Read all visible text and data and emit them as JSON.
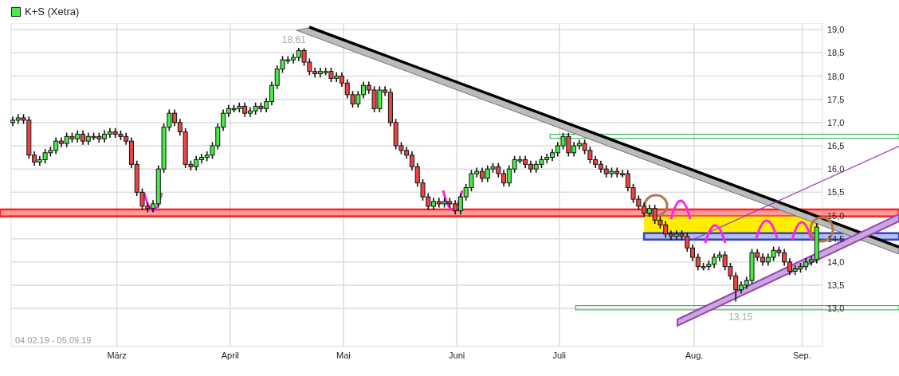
{
  "legend": {
    "label": "K+S (Xetra)",
    "color": "#44ee44"
  },
  "date_range": "04.02.19 - 05.09.19",
  "chart_data": {
    "type": "candlestick",
    "grid": true,
    "ylim": [
      12.18,
      19.14
    ],
    "yticks": [
      {
        "value": 13,
        "label": "13,0"
      },
      {
        "value": 13.5,
        "label": "13,5"
      },
      {
        "value": 14,
        "label": "14,0"
      },
      {
        "value": 14.5,
        "label": "14,5"
      },
      {
        "value": 15,
        "label": "15,0"
      },
      {
        "value": 15.5,
        "label": "15,5"
      },
      {
        "value": 16,
        "label": "16,0"
      },
      {
        "value": 16.5,
        "label": "16,5"
      },
      {
        "value": 17,
        "label": "17,0"
      },
      {
        "value": 17.5,
        "label": "17,5"
      },
      {
        "value": 18,
        "label": "18,0"
      },
      {
        "value": 18.5,
        "label": "18,5"
      },
      {
        "value": 19,
        "label": "19,0"
      }
    ],
    "categories": [
      null,
      null,
      null,
      null,
      null,
      null,
      null,
      null,
      null,
      null,
      null,
      null,
      null,
      null,
      null,
      null,
      null,
      null,
      null,
      "März",
      null,
      null,
      null,
      null,
      null,
      null,
      null,
      null,
      null,
      null,
      null,
      null,
      null,
      null,
      null,
      null,
      null,
      null,
      null,
      null,
      "April",
      null,
      null,
      null,
      null,
      null,
      null,
      null,
      null,
      null,
      null,
      null,
      null,
      null,
      null,
      null,
      null,
      null,
      null,
      null,
      null,
      "Mai",
      null,
      null,
      null,
      null,
      null,
      null,
      null,
      null,
      null,
      null,
      null,
      null,
      null,
      null,
      null,
      null,
      null,
      null,
      null,
      null,
      "Juni",
      null,
      null,
      null,
      null,
      null,
      null,
      null,
      null,
      null,
      null,
      null,
      null,
      null,
      null,
      null,
      null,
      null,
      null,
      "Juli",
      null,
      null,
      null,
      null,
      null,
      null,
      null,
      null,
      null,
      null,
      null,
      null,
      null,
      null,
      null,
      null,
      null,
      null,
      null,
      null,
      null,
      null,
      null,
      null,
      "Aug.",
      null,
      null,
      null,
      null,
      null,
      null,
      null,
      null,
      null,
      null,
      null,
      null,
      null,
      null,
      null,
      null,
      null,
      null,
      null,
      "Sep.",
      null,
      null,
      null
    ],
    "ohlc": [
      [
        17.0,
        17.13,
        16.92,
        17.05
      ],
      [
        17.05,
        17.18,
        16.97,
        17.1
      ],
      [
        17.1,
        17.18,
        16.97,
        17.05
      ],
      [
        17.05,
        17.13,
        16.22,
        16.3
      ],
      [
        16.3,
        16.38,
        16.07,
        16.15
      ],
      [
        16.15,
        16.28,
        16.07,
        16.2
      ],
      [
        16.2,
        16.43,
        16.12,
        16.35
      ],
      [
        16.35,
        16.48,
        16.27,
        16.4
      ],
      [
        16.4,
        16.68,
        16.32,
        16.6
      ],
      [
        16.6,
        16.68,
        16.47,
        16.55
      ],
      [
        16.55,
        16.78,
        16.47,
        16.7
      ],
      [
        16.7,
        16.78,
        16.57,
        16.65
      ],
      [
        16.65,
        16.83,
        16.57,
        16.75
      ],
      [
        16.75,
        16.83,
        16.52,
        16.6
      ],
      [
        16.6,
        16.78,
        16.52,
        16.7
      ],
      [
        16.7,
        16.78,
        16.62,
        16.7
      ],
      [
        16.7,
        16.78,
        16.57,
        16.65
      ],
      [
        16.65,
        16.83,
        16.57,
        16.75
      ],
      [
        16.75,
        16.88,
        16.67,
        16.8
      ],
      [
        16.8,
        16.88,
        16.67,
        16.75
      ],
      [
        16.75,
        16.83,
        16.62,
        16.7
      ],
      [
        16.7,
        16.78,
        16.52,
        16.6
      ],
      [
        16.6,
        16.68,
        16.02,
        16.1
      ],
      [
        16.1,
        16.18,
        15.42,
        15.5
      ],
      [
        15.5,
        15.58,
        15.12,
        15.2
      ],
      [
        15.2,
        15.28,
        15.07,
        15.15
      ],
      [
        15.15,
        15.33,
        15.07,
        15.25
      ],
      [
        15.25,
        16.08,
        15.17,
        16.0
      ],
      [
        16.0,
        16.98,
        15.92,
        16.9
      ],
      [
        16.9,
        17.28,
        16.82,
        17.2
      ],
      [
        17.2,
        17.28,
        16.92,
        17.0
      ],
      [
        17.0,
        17.08,
        16.72,
        16.8
      ],
      [
        16.8,
        16.88,
        16.02,
        16.1
      ],
      [
        16.1,
        16.18,
        15.97,
        16.05
      ],
      [
        16.05,
        16.28,
        15.97,
        16.2
      ],
      [
        16.2,
        16.33,
        16.12,
        16.25
      ],
      [
        16.25,
        16.38,
        16.17,
        16.3
      ],
      [
        16.3,
        16.58,
        16.22,
        16.5
      ],
      [
        16.5,
        16.98,
        16.42,
        16.9
      ],
      [
        16.9,
        17.28,
        16.82,
        17.2
      ],
      [
        17.2,
        17.38,
        17.12,
        17.3
      ],
      [
        17.3,
        17.38,
        17.22,
        17.3
      ],
      [
        17.3,
        17.43,
        17.22,
        17.35
      ],
      [
        17.35,
        17.43,
        17.12,
        17.2
      ],
      [
        17.2,
        17.33,
        17.12,
        17.25
      ],
      [
        17.25,
        17.43,
        17.17,
        17.35
      ],
      [
        17.35,
        17.43,
        17.22,
        17.3
      ],
      [
        17.3,
        17.53,
        17.22,
        17.45
      ],
      [
        17.45,
        17.88,
        17.37,
        17.8
      ],
      [
        17.8,
        18.23,
        17.72,
        18.15
      ],
      [
        18.15,
        18.43,
        18.07,
        18.35
      ],
      [
        18.35,
        18.43,
        18.27,
        18.35
      ],
      [
        18.35,
        18.48,
        18.27,
        18.4
      ],
      [
        18.4,
        18.61,
        18.32,
        18.55
      ],
      [
        18.55,
        18.6,
        18.22,
        18.3
      ],
      [
        18.3,
        18.38,
        18.02,
        18.1
      ],
      [
        18.1,
        18.18,
        17.97,
        18.05
      ],
      [
        18.05,
        18.18,
        17.97,
        18.1
      ],
      [
        18.1,
        18.18,
        18.02,
        18.1
      ],
      [
        18.1,
        18.18,
        17.87,
        17.95
      ],
      [
        17.95,
        18.08,
        17.87,
        18.0
      ],
      [
        18.0,
        18.08,
        17.77,
        17.85
      ],
      [
        17.85,
        17.93,
        17.52,
        17.6
      ],
      [
        17.6,
        17.68,
        17.32,
        17.4
      ],
      [
        17.4,
        17.68,
        17.32,
        17.6
      ],
      [
        17.6,
        17.88,
        17.52,
        17.8
      ],
      [
        17.8,
        17.88,
        17.62,
        17.7
      ],
      [
        17.7,
        17.78,
        17.22,
        17.3
      ],
      [
        17.3,
        17.78,
        17.22,
        17.7
      ],
      [
        17.7,
        17.78,
        17.57,
        17.65
      ],
      [
        17.65,
        17.73,
        16.92,
        17.0
      ],
      [
        17.0,
        17.08,
        16.42,
        16.5
      ],
      [
        16.5,
        16.58,
        16.32,
        16.4
      ],
      [
        16.4,
        16.48,
        16.22,
        16.3
      ],
      [
        16.3,
        16.38,
        15.97,
        16.05
      ],
      [
        16.05,
        16.13,
        15.62,
        15.7
      ],
      [
        15.7,
        15.78,
        15.32,
        15.4
      ],
      [
        15.4,
        15.48,
        15.12,
        15.2
      ],
      [
        15.2,
        15.38,
        15.12,
        15.3
      ],
      [
        15.3,
        15.38,
        15.17,
        15.25
      ],
      [
        15.25,
        15.38,
        15.17,
        15.3
      ],
      [
        15.3,
        15.38,
        15.17,
        15.25
      ],
      [
        15.25,
        15.33,
        15.02,
        15.1
      ],
      [
        15.1,
        15.48,
        15.02,
        15.4
      ],
      [
        15.4,
        15.68,
        15.32,
        15.6
      ],
      [
        15.6,
        15.98,
        15.52,
        15.9
      ],
      [
        15.9,
        16.03,
        15.82,
        15.95
      ],
      [
        15.95,
        16.03,
        15.72,
        15.8
      ],
      [
        15.8,
        16.08,
        15.72,
        16.0
      ],
      [
        16.0,
        16.13,
        15.92,
        16.05
      ],
      [
        16.05,
        16.13,
        15.82,
        15.9
      ],
      [
        15.9,
        15.98,
        15.62,
        15.7
      ],
      [
        15.7,
        16.08,
        15.62,
        16.0
      ],
      [
        16.0,
        16.28,
        15.92,
        16.2
      ],
      [
        16.2,
        16.28,
        16.12,
        16.2
      ],
      [
        16.2,
        16.28,
        16.02,
        16.1
      ],
      [
        16.1,
        16.18,
        15.92,
        16.0
      ],
      [
        16.0,
        16.18,
        15.92,
        16.1
      ],
      [
        16.1,
        16.28,
        16.02,
        16.2
      ],
      [
        16.2,
        16.33,
        16.12,
        16.25
      ],
      [
        16.25,
        16.43,
        16.17,
        16.35
      ],
      [
        16.35,
        16.58,
        16.27,
        16.5
      ],
      [
        16.5,
        16.78,
        16.42,
        16.7
      ],
      [
        16.7,
        16.78,
        16.27,
        16.35
      ],
      [
        16.35,
        16.58,
        16.27,
        16.5
      ],
      [
        16.5,
        16.63,
        16.42,
        16.55
      ],
      [
        16.55,
        16.63,
        16.32,
        16.4
      ],
      [
        16.4,
        16.48,
        16.12,
        16.2
      ],
      [
        16.2,
        16.28,
        16.02,
        16.1
      ],
      [
        16.1,
        16.18,
        15.92,
        16.0
      ],
      [
        16.0,
        16.08,
        15.82,
        15.9
      ],
      [
        15.9,
        16.03,
        15.82,
        15.95
      ],
      [
        15.95,
        16.03,
        15.82,
        15.9
      ],
      [
        15.9,
        15.98,
        15.82,
        15.9
      ],
      [
        15.9,
        15.98,
        15.52,
        15.6
      ],
      [
        15.6,
        15.68,
        15.27,
        15.35
      ],
      [
        15.35,
        15.43,
        15.12,
        15.2
      ],
      [
        15.2,
        15.28,
        14.97,
        15.05
      ],
      [
        15.05,
        15.23,
        14.97,
        15.15
      ],
      [
        15.15,
        15.23,
        14.82,
        14.9
      ],
      [
        14.9,
        14.98,
        14.72,
        14.8
      ],
      [
        14.8,
        14.88,
        14.52,
        14.6
      ],
      [
        14.6,
        14.68,
        14.47,
        14.55
      ],
      [
        14.55,
        14.68,
        14.47,
        14.6
      ],
      [
        14.6,
        14.68,
        14.47,
        14.55
      ],
      [
        14.55,
        14.63,
        14.22,
        14.3
      ],
      [
        14.3,
        14.38,
        14.02,
        14.1
      ],
      [
        14.1,
        14.18,
        13.82,
        13.9
      ],
      [
        13.9,
        13.98,
        13.82,
        13.9
      ],
      [
        13.9,
        14.03,
        13.82,
        13.95
      ],
      [
        13.95,
        14.18,
        13.87,
        14.1
      ],
      [
        14.1,
        14.23,
        14.02,
        14.15
      ],
      [
        14.15,
        14.23,
        13.82,
        13.9
      ],
      [
        13.9,
        13.98,
        13.62,
        13.7
      ],
      [
        13.7,
        13.78,
        13.15,
        13.4
      ],
      [
        13.4,
        13.58,
        13.32,
        13.5
      ],
      [
        13.5,
        13.68,
        13.42,
        13.6
      ],
      [
        13.6,
        14.28,
        13.52,
        14.2
      ],
      [
        14.2,
        14.28,
        14.02,
        14.1
      ],
      [
        14.1,
        14.18,
        13.92,
        14.0
      ],
      [
        14.0,
        14.18,
        13.92,
        14.1
      ],
      [
        14.1,
        14.33,
        14.02,
        14.25
      ],
      [
        14.25,
        14.33,
        14.12,
        14.2
      ],
      [
        14.2,
        14.28,
        13.92,
        14.0
      ],
      [
        14.0,
        14.08,
        13.72,
        13.8
      ],
      [
        13.8,
        13.93,
        13.72,
        13.85
      ],
      [
        13.85,
        13.98,
        13.77,
        13.9
      ],
      [
        13.9,
        14.08,
        13.82,
        14.0
      ],
      [
        14.0,
        14.13,
        13.92,
        14.05
      ],
      [
        14.05,
        14.83,
        13.97,
        14.75
      ]
    ],
    "annotations": [
      "18,61",
      "13,15"
    ]
  }
}
